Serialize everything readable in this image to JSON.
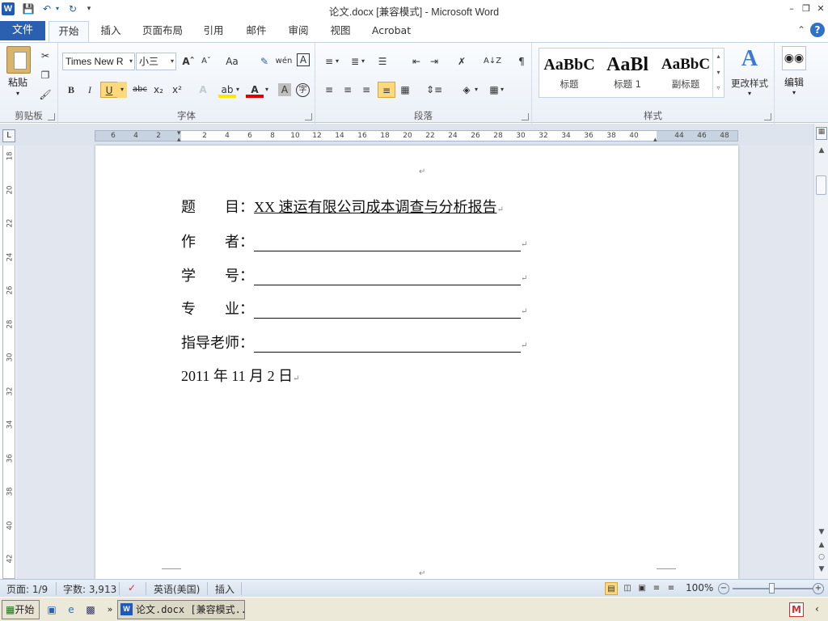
{
  "titlebar": {
    "app_logo": "W",
    "title": "论文.docx [兼容模式] - Microsoft Word",
    "qat": {
      "save_icon": "floppy-icon",
      "undo_icon": "undo-icon",
      "redo_icon": "redo-icon"
    }
  },
  "tabs": {
    "file": "文件",
    "items": [
      "开始",
      "插入",
      "页面布局",
      "引用",
      "邮件",
      "审阅",
      "视图",
      "Acrobat"
    ],
    "active": "开始"
  },
  "ribbon": {
    "clipboard": {
      "paste_label": "粘贴",
      "group_label": "剪贴板"
    },
    "font": {
      "font_name": "Times New R",
      "font_size": "小三",
      "group_label": "字体"
    },
    "paragraph": {
      "group_label": "段落"
    },
    "styles": {
      "group_label": "样式",
      "tiles": [
        {
          "sample": "AaBbC",
          "name": "标题"
        },
        {
          "sample": "AaBl",
          "name": "标题 1"
        },
        {
          "sample": "AaBbC",
          "name": "副标题"
        }
      ],
      "change_styles": "更改样式"
    },
    "editing": {
      "label": "编辑"
    }
  },
  "ruler": {
    "h_ticks": [
      "6",
      "4",
      "2",
      "2",
      "4",
      "6",
      "8",
      "10",
      "12",
      "14",
      "16",
      "18",
      "20",
      "22",
      "24",
      "26",
      "28",
      "30",
      "32",
      "34",
      "36",
      "38",
      "40",
      "44",
      "46",
      "48"
    ],
    "v_ticks": [
      "18",
      "20",
      "22",
      "24",
      "26",
      "28",
      "30",
      "32",
      "34",
      "36",
      "38",
      "40",
      "42"
    ]
  },
  "document": {
    "title_label": "题　　目：",
    "title_value": "XX 速运有限公司成本调查与分析报告",
    "author_label": "作　　者：",
    "student_id_label": "学　　号：",
    "major_label": "专　　业：",
    "advisor_label": "指导老师：",
    "date": "2011 年 11 月 2 日",
    "para_mark": "↵"
  },
  "statusbar": {
    "page": "页面: 1/9",
    "words": "字数: 3,913",
    "language": "英语(美国)",
    "mode": "插入",
    "zoom": "100%"
  },
  "taskbar": {
    "start": "开始",
    "task_label": "论文.docx [兼容模式..."
  }
}
